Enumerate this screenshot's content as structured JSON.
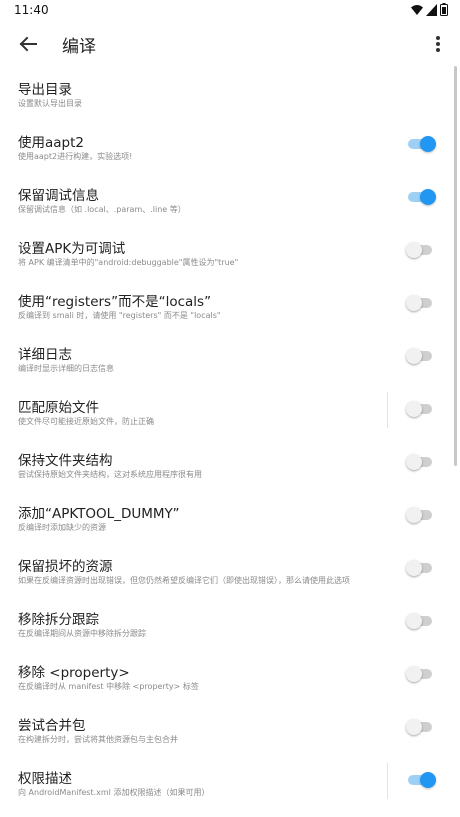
{
  "status": {
    "time": "11:40"
  },
  "header": {
    "title": "编译"
  },
  "rows": [
    {
      "title": "导出目录",
      "subtitle": "设置默认导出目录"
    },
    {
      "title": "使用aapt2",
      "subtitle": "使用aapt2进行构建，实验选项!"
    },
    {
      "title": "保留调试信息",
      "subtitle": "保留调试信息（如 .local、.param、.line 等）"
    },
    {
      "title": "设置APK为可调试",
      "subtitle": "将 APK 编译清单中的\"android:debuggable\"属性设为\"true\""
    },
    {
      "title": "使用“registers”而不是“locals”",
      "subtitle": "反编译到 smali 时，请使用 \"registers\" 而不是 \"locals\""
    },
    {
      "title": "详细日志",
      "subtitle": "编译时显示详细的日志信息"
    },
    {
      "title": "匹配原始文件",
      "subtitle": "使文件尽可能接近原始文件，防止正确"
    },
    {
      "title": "保持文件夹结构",
      "subtitle": "尝试保持原始文件夹结构，这对系统应用程序很有用"
    },
    {
      "title": "添加“APKTOOL_DUMMY”",
      "subtitle": "反编译时添加缺少的资源"
    },
    {
      "title": "保留损坏的资源",
      "subtitle": "如果在反编译资源时出现错误，但您仍然希望反编译它们（即使出现错误），那么请使用此选项"
    },
    {
      "title": "移除拆分跟踪",
      "subtitle": "在反编译期间从资源中移除拆分跟踪"
    },
    {
      "title": "移除 <property>",
      "subtitle": "在反编译时从 manifest 中移除 <property> 标签"
    },
    {
      "title": "尝试合并包",
      "subtitle": "在构建拆分时，尝试将其他资源包与主包合并"
    },
    {
      "title": "权限描述",
      "subtitle": "向 AndroidManifest.xml 添加权限描述（如果可用）"
    }
  ],
  "toggles": [
    null,
    true,
    true,
    false,
    false,
    false,
    false,
    false,
    false,
    false,
    false,
    false,
    false,
    true
  ],
  "colors": {
    "accent": "#2196f3",
    "accent_track": "#9ed0f5"
  }
}
